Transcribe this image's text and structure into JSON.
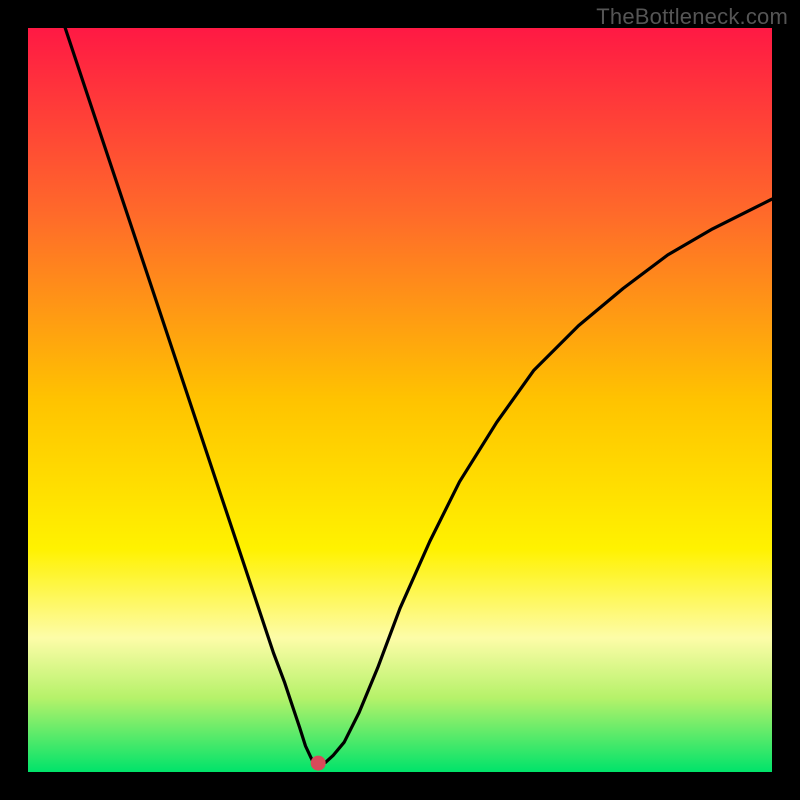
{
  "watermark": "TheBottleneck.com",
  "chart_data": {
    "type": "line",
    "title": "",
    "xlabel": "",
    "ylabel": "",
    "xlim": [
      0,
      100
    ],
    "ylim": [
      0,
      100
    ],
    "grid": false,
    "legend": false,
    "gradient_stops": [
      {
        "offset": 0.0,
        "color": "#ff1944"
      },
      {
        "offset": 0.25,
        "color": "#ff6a2a"
      },
      {
        "offset": 0.5,
        "color": "#ffc300"
      },
      {
        "offset": 0.7,
        "color": "#fff200"
      },
      {
        "offset": 0.82,
        "color": "#fdfca8"
      },
      {
        "offset": 0.9,
        "color": "#b6f26a"
      },
      {
        "offset": 1.0,
        "color": "#00e36a"
      }
    ],
    "series": [
      {
        "name": "bottleneck-curve",
        "x": [
          5,
          8,
          11,
          14,
          17,
          20,
          23,
          26,
          29,
          31,
          33,
          34.5,
          35.5,
          36.5,
          37.3,
          38,
          38.5,
          39,
          40,
          41,
          42.5,
          44.5,
          47,
          50,
          54,
          58,
          63,
          68,
          74,
          80,
          86,
          92,
          98,
          100
        ],
        "y": [
          100,
          91,
          82,
          73,
          64,
          55,
          46,
          37,
          28,
          22,
          16,
          12,
          9,
          6,
          3.5,
          2,
          1,
          1,
          1.3,
          2.2,
          4,
          8,
          14,
          22,
          31,
          39,
          47,
          54,
          60,
          65,
          69.5,
          73,
          76,
          77
        ]
      }
    ],
    "marker": {
      "x": 39,
      "y": 1.2,
      "color": "#d84a5a",
      "radius_px": 7
    },
    "colors": {
      "plot_border": "#000000",
      "curve": "#000000"
    }
  }
}
